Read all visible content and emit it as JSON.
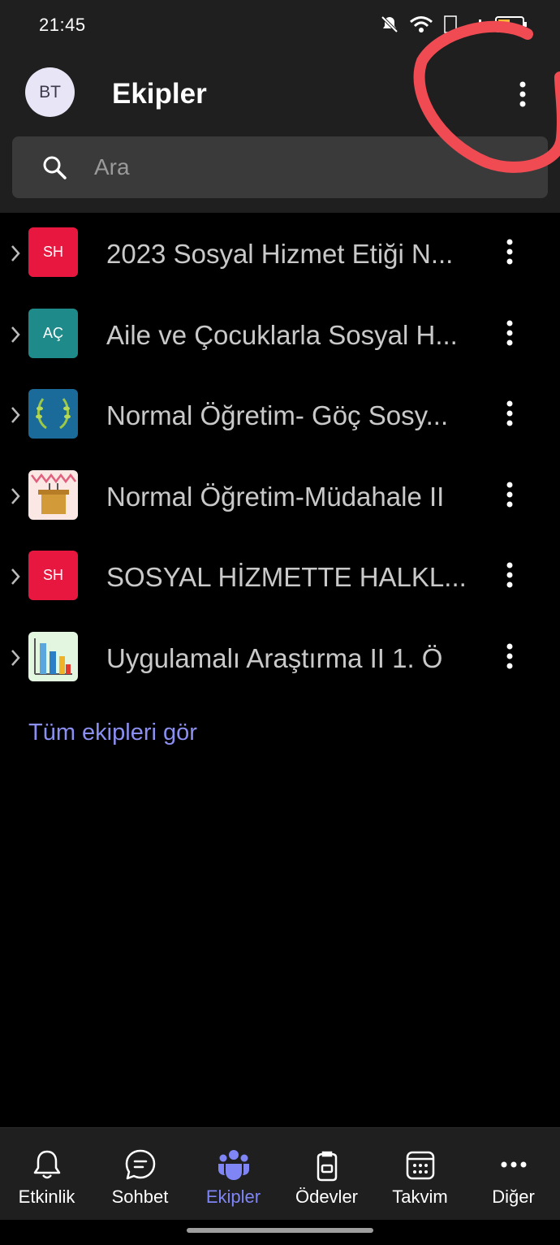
{
  "status": {
    "time": "21:45"
  },
  "header": {
    "avatar_initials": "BT",
    "title": "Ekipler"
  },
  "search": {
    "placeholder": "Ara"
  },
  "teams": [
    {
      "name": "2023 Sosyal Hizmet Etiği N...",
      "tile_text": "SH",
      "tile_color": "#e8173f"
    },
    {
      "name": "Aile ve Çocuklarla Sosyal H...",
      "tile_text": "AÇ",
      "tile_color": "#1f8a8a"
    },
    {
      "name": "Normal Öğretim- Göç Sosy...",
      "tile_text": "",
      "tile_color": "#1a6a9a"
    },
    {
      "name": "Normal Öğretim-Müdahale II",
      "tile_text": "",
      "tile_color": "#fbe8e4"
    },
    {
      "name": "SOSYAL HİZMETTE HALKL...",
      "tile_text": "SH",
      "tile_color": "#e8173f"
    },
    {
      "name": "Uygulamalı Araştırma II 1. Ö",
      "tile_text": "",
      "tile_color": "#e3f6e0"
    }
  ],
  "see_all": "Tüm ekipleri gör",
  "nav": [
    {
      "label": "Etkinlik",
      "icon": "bell-icon"
    },
    {
      "label": "Sohbet",
      "icon": "chat-icon"
    },
    {
      "label": "Ekipler",
      "icon": "teams-icon",
      "active": true
    },
    {
      "label": "Ödevler",
      "icon": "assignments-icon"
    },
    {
      "label": "Takvim",
      "icon": "calendar-icon"
    },
    {
      "label": "Diğer",
      "icon": "more-icon"
    }
  ],
  "colors": {
    "accent": "#7f85f5",
    "annotation": "#f04b52"
  }
}
